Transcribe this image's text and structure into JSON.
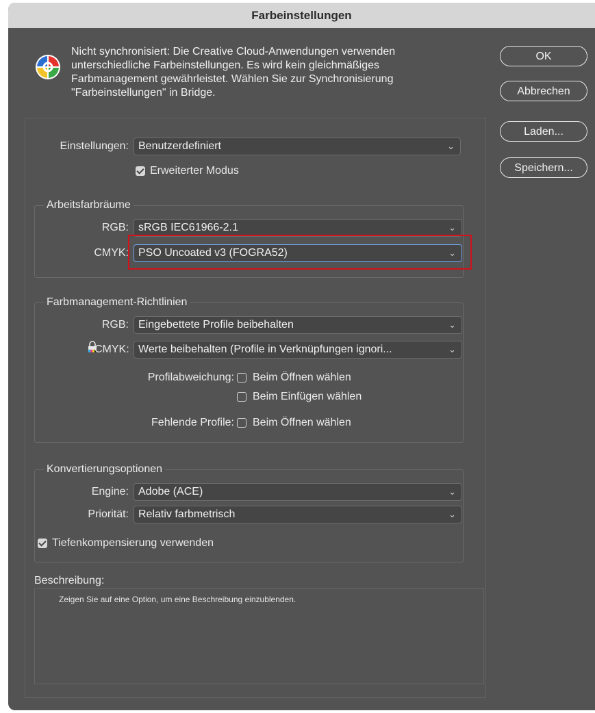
{
  "window": {
    "title": "Farbeinstellungen"
  },
  "sync_notice": {
    "lines": [
      "Nicht synchronisiert: Die Creative Cloud-Anwendungen verwenden",
      "unterschiedliche Farbeinstellungen. Es wird kein gleichmäßiges",
      "Farbmanagement gewährleistet. Wählen Sie zur Synchronisierung",
      "\"Farbeinstellungen\" in Bridge."
    ],
    "icon": "color-wheel-icon"
  },
  "buttons": {
    "ok": "OK",
    "cancel": "Abbrechen",
    "load": "Laden...",
    "save": "Speichern..."
  },
  "settings": {
    "label": "Einstellungen:",
    "value": "Benutzerdefiniert",
    "advanced_mode": {
      "label": "Erweiterter Modus",
      "checked": true
    }
  },
  "working_spaces": {
    "legend": "Arbeitsfarbräume",
    "rgb_label": "RGB:",
    "rgb_value": "sRGB IEC61966-2.1",
    "cmyk_label": "CMYK:",
    "cmyk_value": "PSO Uncoated v3 (FOGRA52)"
  },
  "policies": {
    "legend": "Farbmanagement-Richtlinien",
    "rgb_label": "RGB:",
    "rgb_value": "Eingebettete Profile beibehalten",
    "cmyk_label": "CMYK:",
    "cmyk_value": "Werte beibehalten (Profile in Verknüpfungen ignori...",
    "mismatch_label": "Profilabweichung:",
    "mismatch_open": {
      "label": "Beim Öffnen wählen",
      "checked": false
    },
    "mismatch_paste": {
      "label": "Beim Einfügen wählen",
      "checked": false
    },
    "missing_label": "Fehlende Profile:",
    "missing_open": {
      "label": "Beim Öffnen wählen",
      "checked": false
    }
  },
  "conversion": {
    "legend": "Konvertierungsoptionen",
    "engine_label": "Engine:",
    "engine_value": "Adobe (ACE)",
    "intent_label": "Priorität:",
    "intent_value": "Relativ farbmetrisch",
    "bpc": {
      "label": "Tiefenkompensierung verwenden",
      "checked": true
    }
  },
  "description": {
    "label": "Beschreibung:",
    "text": "Zeigen Sie auf eine Option, um eine Beschreibung einzublenden."
  },
  "colors": {
    "window_bg": "#535353",
    "titlebar_bg": "#d6d6d6",
    "highlight": "#d0121b",
    "focus": "#6fa3e8"
  }
}
